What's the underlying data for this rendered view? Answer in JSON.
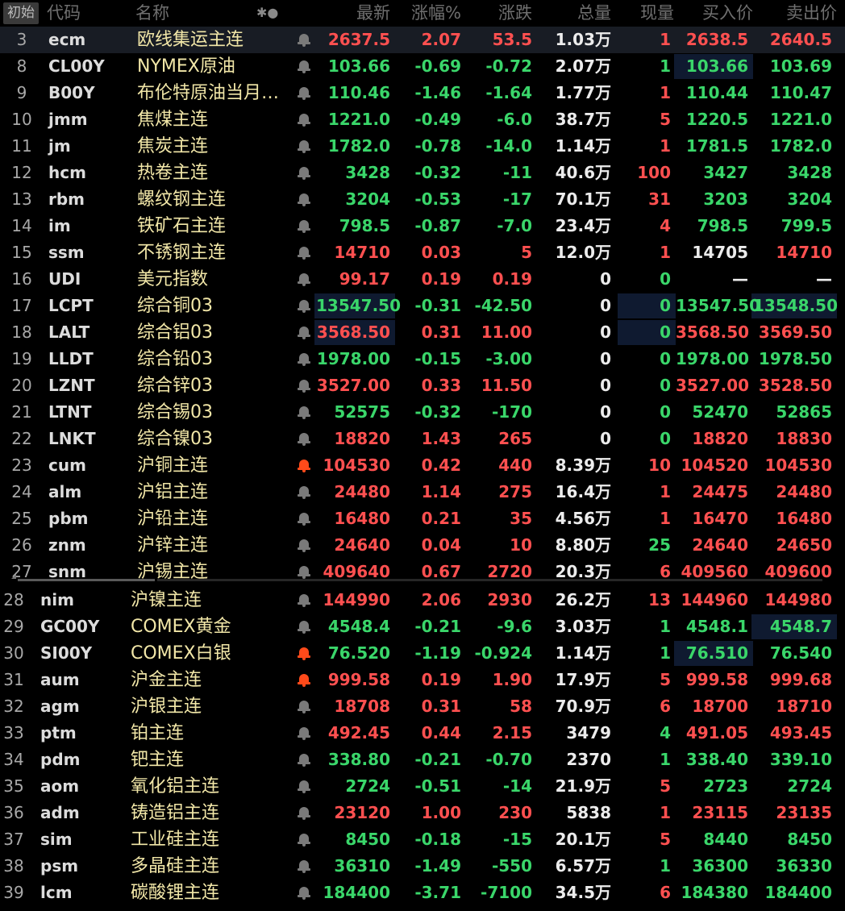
{
  "header": {
    "init": "初始",
    "code": "代码",
    "name": "名称",
    "star": "✱●",
    "last": "最新",
    "pct": "涨幅%",
    "chg": "涨跌",
    "vol": "总量",
    "cur": "现量",
    "bid": "买入价",
    "ask": "卖出价"
  },
  "rows": [
    {
      "n": "3",
      "code": "ecm",
      "name": "欧线集运主连",
      "bell": "off",
      "last": "2637.5",
      "pct": "2.07",
      "chg": "53.5",
      "vol": "1.03万",
      "cur": "1",
      "bid": "2638.5",
      "ask": "2640.5"
    },
    {
      "n": "8",
      "code": "CL00Y",
      "name": "NYMEX原油",
      "bell": "off",
      "last": "103.66",
      "pct": "-0.69",
      "chg": "-0.72",
      "vol": "2.07万",
      "cur": "1",
      "bid": "103.66",
      "ask": "103.69"
    },
    {
      "n": "9",
      "code": "B00Y",
      "name": "布伦特原油当月连续",
      "bell": "off",
      "last": "110.46",
      "pct": "-1.46",
      "chg": "-1.64",
      "vol": "1.77万",
      "cur": "1",
      "bid": "110.44",
      "ask": "110.47"
    },
    {
      "n": "10",
      "code": "jmm",
      "name": "焦煤主连",
      "bell": "off",
      "last": "1221.0",
      "pct": "-0.49",
      "chg": "-6.0",
      "vol": "38.7万",
      "cur": "5",
      "bid": "1220.5",
      "ask": "1221.0"
    },
    {
      "n": "11",
      "code": "jm",
      "name": "焦炭主连",
      "bell": "off",
      "last": "1782.0",
      "pct": "-0.78",
      "chg": "-14.0",
      "vol": "1.14万",
      "cur": "1",
      "bid": "1781.5",
      "ask": "1782.0"
    },
    {
      "n": "12",
      "code": "hcm",
      "name": "热卷主连",
      "bell": "off",
      "last": "3428",
      "pct": "-0.32",
      "chg": "-11",
      "vol": "40.6万",
      "cur": "100",
      "bid": "3427",
      "ask": "3428"
    },
    {
      "n": "13",
      "code": "rbm",
      "name": "螺纹钢主连",
      "bell": "off",
      "last": "3204",
      "pct": "-0.53",
      "chg": "-17",
      "vol": "70.1万",
      "cur": "31",
      "bid": "3203",
      "ask": "3204"
    },
    {
      "n": "14",
      "code": "im",
      "name": "铁矿石主连",
      "bell": "off",
      "last": "798.5",
      "pct": "-0.87",
      "chg": "-7.0",
      "vol": "23.4万",
      "cur": "4",
      "bid": "798.5",
      "ask": "799.5"
    },
    {
      "n": "15",
      "code": "ssm",
      "name": "不锈钢主连",
      "bell": "off",
      "last": "14710",
      "pct": "0.03",
      "chg": "5",
      "vol": "12.0万",
      "cur": "1",
      "bid": "14705",
      "ask": "14710"
    },
    {
      "n": "16",
      "code": "UDI",
      "name": "美元指数",
      "bell": "off",
      "last": "99.17",
      "pct": "0.19",
      "chg": "0.19",
      "vol": "0",
      "cur": "0",
      "bid": "—",
      "ask": "—"
    },
    {
      "n": "17",
      "code": "LCPT",
      "name": "综合铜03",
      "bell": "off",
      "last": "13547.50",
      "pct": "-0.31",
      "chg": "-42.50",
      "vol": "0",
      "cur": "0",
      "bid": "13547.50",
      "ask": "13548.50"
    },
    {
      "n": "18",
      "code": "LALT",
      "name": "综合铝03",
      "bell": "off",
      "last": "3568.50",
      "pct": "0.31",
      "chg": "11.00",
      "vol": "0",
      "cur": "0",
      "bid": "3568.50",
      "ask": "3569.50"
    },
    {
      "n": "19",
      "code": "LLDT",
      "name": "综合铅03",
      "bell": "off",
      "last": "1978.00",
      "pct": "-0.15",
      "chg": "-3.00",
      "vol": "0",
      "cur": "0",
      "bid": "1978.00",
      "ask": "1978.50"
    },
    {
      "n": "20",
      "code": "LZNT",
      "name": "综合锌03",
      "bell": "off",
      "last": "3527.00",
      "pct": "0.33",
      "chg": "11.50",
      "vol": "0",
      "cur": "0",
      "bid": "3527.00",
      "ask": "3528.50"
    },
    {
      "n": "21",
      "code": "LTNT",
      "name": "综合锡03",
      "bell": "off",
      "last": "52575",
      "pct": "-0.32",
      "chg": "-170",
      "vol": "0",
      "cur": "0",
      "bid": "52470",
      "ask": "52865"
    },
    {
      "n": "22",
      "code": "LNKT",
      "name": "综合镍03",
      "bell": "off",
      "last": "18820",
      "pct": "1.43",
      "chg": "265",
      "vol": "0",
      "cur": "0",
      "bid": "18820",
      "ask": "18830"
    },
    {
      "n": "23",
      "code": "cum",
      "name": "沪铜主连",
      "bell": "on",
      "last": "104530",
      "pct": "0.42",
      "chg": "440",
      "vol": "8.39万",
      "cur": "10",
      "bid": "104520",
      "ask": "104530"
    },
    {
      "n": "24",
      "code": "alm",
      "name": "沪铝主连",
      "bell": "off",
      "last": "24480",
      "pct": "1.14",
      "chg": "275",
      "vol": "16.4万",
      "cur": "1",
      "bid": "24475",
      "ask": "24480"
    },
    {
      "n": "25",
      "code": "pbm",
      "name": "沪铅主连",
      "bell": "off",
      "last": "16480",
      "pct": "0.21",
      "chg": "35",
      "vol": "4.56万",
      "cur": "1",
      "bid": "16470",
      "ask": "16480"
    },
    {
      "n": "26",
      "code": "znm",
      "name": "沪锌主连",
      "bell": "off",
      "last": "24640",
      "pct": "0.04",
      "chg": "10",
      "vol": "8.80万",
      "cur": "25",
      "bid": "24640",
      "ask": "24650"
    },
    {
      "n": "27",
      "code": "snm",
      "name": "沪锡主连",
      "bell": "off",
      "last": "409640",
      "pct": "0.67",
      "chg": "2720",
      "vol": "20.3万",
      "cur": "6",
      "bid": "409560",
      "ask": "409600"
    },
    {
      "n": "28",
      "code": "nim",
      "name": "沪镍主连",
      "bell": "off",
      "last": "144990",
      "pct": "2.06",
      "chg": "2930",
      "vol": "26.2万",
      "cur": "13",
      "bid": "144960",
      "ask": "144980"
    },
    {
      "n": "29",
      "code": "GC00Y",
      "name": "COMEX黄金",
      "bell": "off",
      "last": "4548.4",
      "pct": "-0.21",
      "chg": "-9.6",
      "vol": "3.03万",
      "cur": "1",
      "bid": "4548.1",
      "ask": "4548.7"
    },
    {
      "n": "30",
      "code": "SI00Y",
      "name": "COMEX白银",
      "bell": "on",
      "last": "76.520",
      "pct": "-1.19",
      "chg": "-0.924",
      "vol": "1.14万",
      "cur": "1",
      "bid": "76.510",
      "ask": "76.540"
    },
    {
      "n": "31",
      "code": "aum",
      "name": "沪金主连",
      "bell": "on",
      "last": "999.58",
      "pct": "0.19",
      "chg": "1.90",
      "vol": "17.9万",
      "cur": "5",
      "bid": "999.58",
      "ask": "999.68"
    },
    {
      "n": "32",
      "code": "agm",
      "name": "沪银主连",
      "bell": "off",
      "last": "18708",
      "pct": "0.31",
      "chg": "58",
      "vol": "70.9万",
      "cur": "6",
      "bid": "18700",
      "ask": "18710"
    },
    {
      "n": "33",
      "code": "ptm",
      "name": "铂主连",
      "bell": "off",
      "last": "492.45",
      "pct": "0.44",
      "chg": "2.15",
      "vol": "3479",
      "cur": "4",
      "bid": "491.05",
      "ask": "493.45"
    },
    {
      "n": "34",
      "code": "pdm",
      "name": "钯主连",
      "bell": "off",
      "last": "338.80",
      "pct": "-0.21",
      "chg": "-0.70",
      "vol": "2370",
      "cur": "1",
      "bid": "338.40",
      "ask": "339.10"
    },
    {
      "n": "35",
      "code": "aom",
      "name": "氧化铝主连",
      "bell": "off",
      "last": "2724",
      "pct": "-0.51",
      "chg": "-14",
      "vol": "21.9万",
      "cur": "5",
      "bid": "2723",
      "ask": "2724"
    },
    {
      "n": "36",
      "code": "adm",
      "name": "铸造铝主连",
      "bell": "off",
      "last": "23120",
      "pct": "1.00",
      "chg": "230",
      "vol": "5838",
      "cur": "1",
      "bid": "23115",
      "ask": "23135"
    },
    {
      "n": "37",
      "code": "sim",
      "name": "工业硅主连",
      "bell": "off",
      "last": "8450",
      "pct": "-0.18",
      "chg": "-15",
      "vol": "20.1万",
      "cur": "5",
      "bid": "8440",
      "ask": "8450"
    },
    {
      "n": "38",
      "code": "psm",
      "name": "多晶硅主连",
      "bell": "off",
      "last": "36310",
      "pct": "-1.49",
      "chg": "-550",
      "vol": "6.57万",
      "cur": "1",
      "bid": "36300",
      "ask": "36330"
    },
    {
      "n": "39",
      "code": "lcm",
      "name": "碳酸锂主连",
      "bell": "off",
      "last": "184400",
      "pct": "-3.71",
      "chg": "-7100",
      "vol": "34.5万",
      "cur": "6",
      "bid": "184380",
      "ask": "184400"
    }
  ],
  "colors": {
    "up": "#ff5050",
    "down": "#3ad66a",
    "flat": "#ececec",
    "name": "#f2e7a8",
    "highlight": "#0f1a30"
  }
}
